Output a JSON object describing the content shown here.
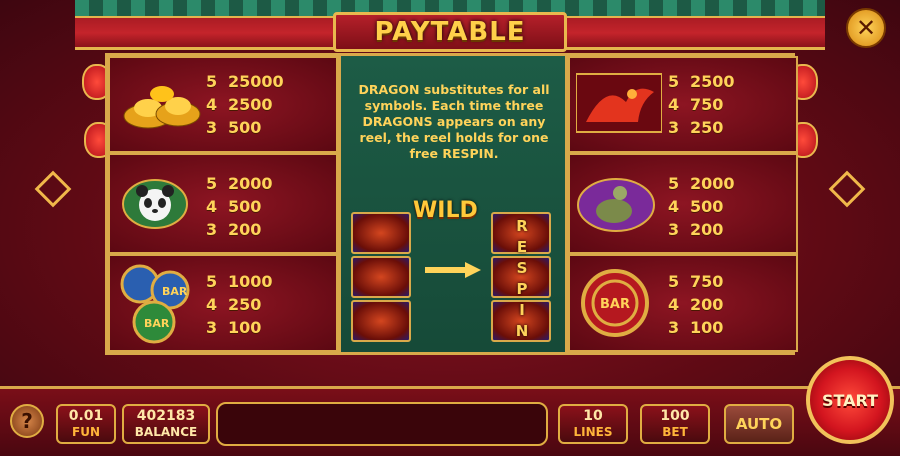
{
  "header": {
    "title": "PAYTABLE",
    "close_label": "✕"
  },
  "left_symbols": [
    {
      "name": "gold-ingots",
      "pays": [
        [
          "5",
          "25000"
        ],
        [
          "4",
          "2500"
        ],
        [
          "3",
          "500"
        ]
      ]
    },
    {
      "name": "panda",
      "pays": [
        [
          "5",
          "2000"
        ],
        [
          "4",
          "500"
        ],
        [
          "3",
          "200"
        ]
      ]
    },
    {
      "name": "bar-coins",
      "pays": [
        [
          "5",
          "1000"
        ],
        [
          "4",
          "250"
        ],
        [
          "3",
          "100"
        ]
      ]
    }
  ],
  "right_symbols": [
    {
      "name": "phoenix",
      "pays": [
        [
          "5",
          "2500"
        ],
        [
          "4",
          "750"
        ],
        [
          "3",
          "250"
        ]
      ]
    },
    {
      "name": "turtle",
      "pays": [
        [
          "5",
          "2000"
        ],
        [
          "4",
          "500"
        ],
        [
          "3",
          "200"
        ]
      ]
    },
    {
      "name": "bar-medallion",
      "pays": [
        [
          "5",
          "750"
        ],
        [
          "4",
          "200"
        ],
        [
          "3",
          "100"
        ]
      ]
    }
  ],
  "wild": {
    "description": "DRAGON substitutes for all symbols. Each time three DRAGONS appears on any reel, the reel holds for one free RESPIN.",
    "title": "WILD",
    "respin_letters": [
      "R",
      "E",
      "S",
      "P",
      "I",
      "N"
    ]
  },
  "bottom": {
    "help_label": "?",
    "fun": {
      "value": "0.01",
      "label": "FUN"
    },
    "balance": {
      "value": "402183",
      "label": "BALANCE"
    },
    "lines": {
      "value": "10",
      "label": "LINES"
    },
    "bet": {
      "value": "100",
      "label": "BET"
    },
    "auto_label": "AUTO",
    "start_label": "START"
  }
}
